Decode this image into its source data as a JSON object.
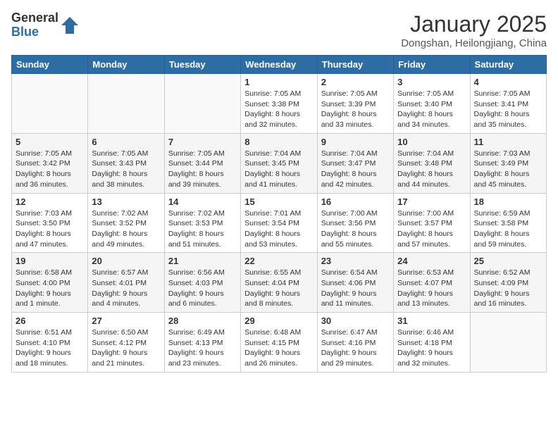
{
  "logo": {
    "general": "General",
    "blue": "Blue"
  },
  "header": {
    "month": "January 2025",
    "location": "Dongshan, Heilongjiang, China"
  },
  "weekdays": [
    "Sunday",
    "Monday",
    "Tuesday",
    "Wednesday",
    "Thursday",
    "Friday",
    "Saturday"
  ],
  "weeks": [
    [
      {
        "day": "",
        "info": ""
      },
      {
        "day": "",
        "info": ""
      },
      {
        "day": "",
        "info": ""
      },
      {
        "day": "1",
        "info": "Sunrise: 7:05 AM\nSunset: 3:38 PM\nDaylight: 8 hours and 32 minutes."
      },
      {
        "day": "2",
        "info": "Sunrise: 7:05 AM\nSunset: 3:39 PM\nDaylight: 8 hours and 33 minutes."
      },
      {
        "day": "3",
        "info": "Sunrise: 7:05 AM\nSunset: 3:40 PM\nDaylight: 8 hours and 34 minutes."
      },
      {
        "day": "4",
        "info": "Sunrise: 7:05 AM\nSunset: 3:41 PM\nDaylight: 8 hours and 35 minutes."
      }
    ],
    [
      {
        "day": "5",
        "info": "Sunrise: 7:05 AM\nSunset: 3:42 PM\nDaylight: 8 hours and 36 minutes."
      },
      {
        "day": "6",
        "info": "Sunrise: 7:05 AM\nSunset: 3:43 PM\nDaylight: 8 hours and 38 minutes."
      },
      {
        "day": "7",
        "info": "Sunrise: 7:05 AM\nSunset: 3:44 PM\nDaylight: 8 hours and 39 minutes."
      },
      {
        "day": "8",
        "info": "Sunrise: 7:04 AM\nSunset: 3:45 PM\nDaylight: 8 hours and 41 minutes."
      },
      {
        "day": "9",
        "info": "Sunrise: 7:04 AM\nSunset: 3:47 PM\nDaylight: 8 hours and 42 minutes."
      },
      {
        "day": "10",
        "info": "Sunrise: 7:04 AM\nSunset: 3:48 PM\nDaylight: 8 hours and 44 minutes."
      },
      {
        "day": "11",
        "info": "Sunrise: 7:03 AM\nSunset: 3:49 PM\nDaylight: 8 hours and 45 minutes."
      }
    ],
    [
      {
        "day": "12",
        "info": "Sunrise: 7:03 AM\nSunset: 3:50 PM\nDaylight: 8 hours and 47 minutes."
      },
      {
        "day": "13",
        "info": "Sunrise: 7:02 AM\nSunset: 3:52 PM\nDaylight: 8 hours and 49 minutes."
      },
      {
        "day": "14",
        "info": "Sunrise: 7:02 AM\nSunset: 3:53 PM\nDaylight: 8 hours and 51 minutes."
      },
      {
        "day": "15",
        "info": "Sunrise: 7:01 AM\nSunset: 3:54 PM\nDaylight: 8 hours and 53 minutes."
      },
      {
        "day": "16",
        "info": "Sunrise: 7:00 AM\nSunset: 3:56 PM\nDaylight: 8 hours and 55 minutes."
      },
      {
        "day": "17",
        "info": "Sunrise: 7:00 AM\nSunset: 3:57 PM\nDaylight: 8 hours and 57 minutes."
      },
      {
        "day": "18",
        "info": "Sunrise: 6:59 AM\nSunset: 3:58 PM\nDaylight: 8 hours and 59 minutes."
      }
    ],
    [
      {
        "day": "19",
        "info": "Sunrise: 6:58 AM\nSunset: 4:00 PM\nDaylight: 9 hours and 1 minute."
      },
      {
        "day": "20",
        "info": "Sunrise: 6:57 AM\nSunset: 4:01 PM\nDaylight: 9 hours and 4 minutes."
      },
      {
        "day": "21",
        "info": "Sunrise: 6:56 AM\nSunset: 4:03 PM\nDaylight: 9 hours and 6 minutes."
      },
      {
        "day": "22",
        "info": "Sunrise: 6:55 AM\nSunset: 4:04 PM\nDaylight: 9 hours and 8 minutes."
      },
      {
        "day": "23",
        "info": "Sunrise: 6:54 AM\nSunset: 4:06 PM\nDaylight: 9 hours and 11 minutes."
      },
      {
        "day": "24",
        "info": "Sunrise: 6:53 AM\nSunset: 4:07 PM\nDaylight: 9 hours and 13 minutes."
      },
      {
        "day": "25",
        "info": "Sunrise: 6:52 AM\nSunset: 4:09 PM\nDaylight: 9 hours and 16 minutes."
      }
    ],
    [
      {
        "day": "26",
        "info": "Sunrise: 6:51 AM\nSunset: 4:10 PM\nDaylight: 9 hours and 18 minutes."
      },
      {
        "day": "27",
        "info": "Sunrise: 6:50 AM\nSunset: 4:12 PM\nDaylight: 9 hours and 21 minutes."
      },
      {
        "day": "28",
        "info": "Sunrise: 6:49 AM\nSunset: 4:13 PM\nDaylight: 9 hours and 23 minutes."
      },
      {
        "day": "29",
        "info": "Sunrise: 6:48 AM\nSunset: 4:15 PM\nDaylight: 9 hours and 26 minutes."
      },
      {
        "day": "30",
        "info": "Sunrise: 6:47 AM\nSunset: 4:16 PM\nDaylight: 9 hours and 29 minutes."
      },
      {
        "day": "31",
        "info": "Sunrise: 6:46 AM\nSunset: 4:18 PM\nDaylight: 9 hours and 32 minutes."
      },
      {
        "day": "",
        "info": ""
      }
    ]
  ]
}
